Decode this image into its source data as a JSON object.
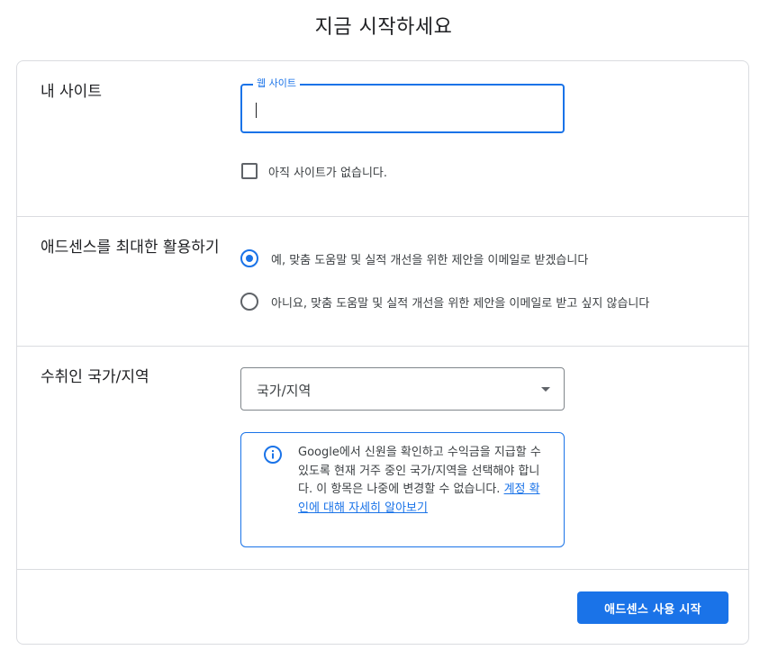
{
  "page": {
    "title": "지금 시작하세요"
  },
  "site": {
    "label": "내 사이트",
    "field_label": "웹 사이트",
    "field_value": "",
    "no_site_label": "아직 사이트가 없습니다.",
    "no_site_checked": false
  },
  "optimize": {
    "label": "애드센스를 최대한 활용하기",
    "options": [
      {
        "label": "예, 맞춤 도움말 및 실적 개선을 위한 제안을 이메일로 받겠습니다",
        "selected": true
      },
      {
        "label": "아니요, 맞춤 도움말 및 실적 개선을 위한 제안을 이메일로 받고 싶지 않습니다",
        "selected": false
      }
    ]
  },
  "country": {
    "label": "수취인 국가/지역",
    "select_value": "국가/지역",
    "info_text": "Google에서 신원을 확인하고 수익금을 지급할 수 있도록 현재 거주 중인 국가/지역을 선택해야 합니다. 이 항목은 나중에 변경할 수 없습니다. ",
    "info_link": "계정 확인에 대해 자세히 알아보기"
  },
  "actions": {
    "start_button": "애드센스 사용 시작"
  },
  "colors": {
    "accent": "#1a73e8",
    "border": "#dadce0",
    "text": "#202124"
  },
  "icons": {
    "info": "info-icon",
    "dropdown": "dropdown-arrow-icon"
  }
}
